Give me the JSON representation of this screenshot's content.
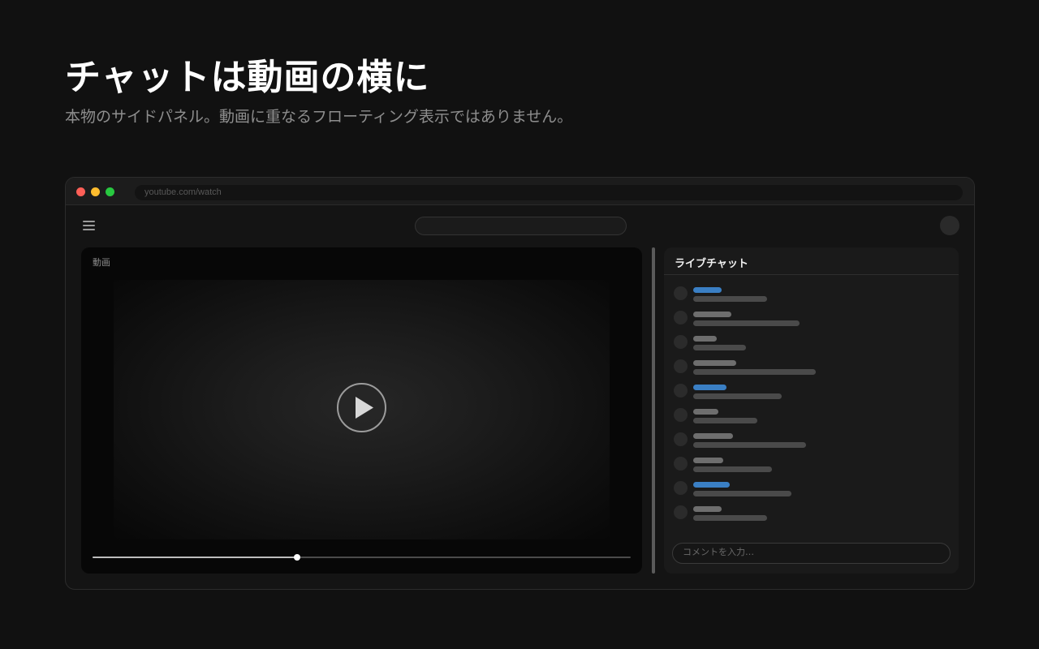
{
  "hero": {
    "title": "チャットは動画の横に",
    "subtitle": "本物のサイドパネル。動画に重なるフローティング表示ではありません。"
  },
  "browser": {
    "url": "youtube.com/watch",
    "window_controls": [
      "close",
      "minimize",
      "maximize"
    ]
  },
  "topbar": {
    "menu_icon": "hamburger-menu-icon",
    "search_placeholder": "",
    "avatar": "user-avatar"
  },
  "video": {
    "label": "動画",
    "play_icon": "play-icon",
    "progress": 0.38
  },
  "chat": {
    "title": "ライブチャット",
    "input_placeholder": "コメントを入力…",
    "messages": [
      {
        "member": true
      },
      {
        "member": false
      },
      {
        "member": false
      },
      {
        "member": false
      },
      {
        "member": true
      },
      {
        "member": false
      },
      {
        "member": false
      },
      {
        "member": false
      },
      {
        "member": true
      },
      {
        "member": false
      }
    ]
  },
  "colors": {
    "background": "#111111",
    "accent_blue": "#3a7fc4",
    "close_dot": "#fe5f57",
    "minimize_dot": "#febc2e",
    "maximize_dot": "#28c840"
  }
}
